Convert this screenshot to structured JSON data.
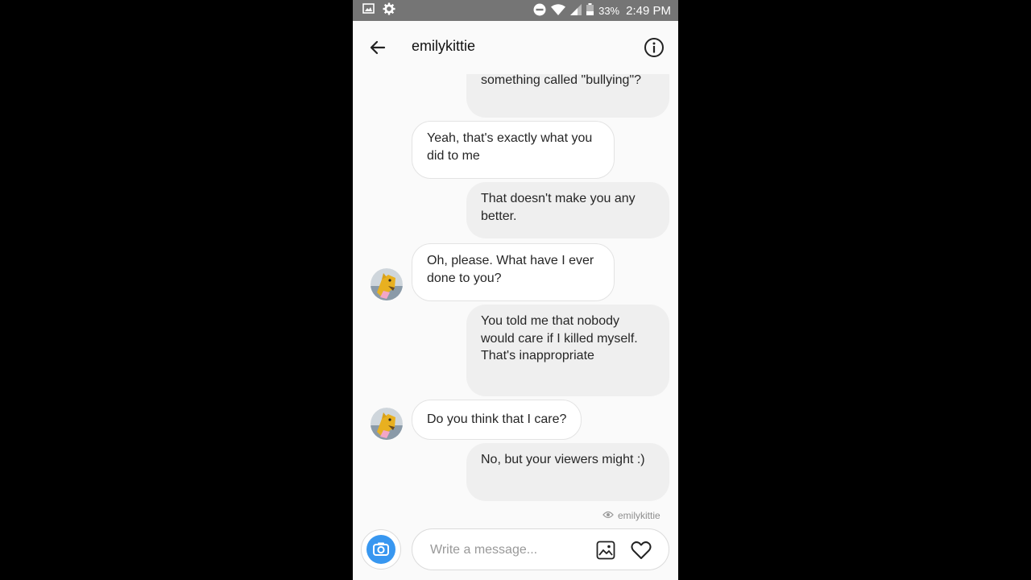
{
  "status_bar": {
    "battery": "33%",
    "time": "2:49 PM",
    "icons": [
      "image-icon",
      "settings-icon",
      "do-not-disturb-icon",
      "wifi-icon",
      "signal-icon",
      "battery-icon"
    ]
  },
  "header": {
    "title": "emilykittie",
    "back_icon": "back-arrow-icon",
    "info_icon": "info-icon"
  },
  "messages": [
    {
      "direction": "out",
      "text": "something called \"bullying\"?"
    },
    {
      "direction": "in",
      "text": "Yeah, that's exactly what you did to me"
    },
    {
      "direction": "out",
      "text": "That doesn't make you any better."
    },
    {
      "direction": "in",
      "text": "Oh, please. What have I ever done to you?",
      "avatar": true
    },
    {
      "direction": "out",
      "text": "You told me that nobody would care if I killed myself. That's inappropriate"
    },
    {
      "direction": "in",
      "text": "Do you think that I care?",
      "avatar": true
    },
    {
      "direction": "out",
      "text": "No, but your viewers might :)"
    }
  ],
  "seen_receipt": {
    "label": "emilykittie",
    "icon": "eye-icon"
  },
  "composer": {
    "placeholder": "Write a message...",
    "value": "",
    "camera_icon": "camera-icon",
    "gallery_icon": "gallery-icon",
    "like_icon": "heart-icon"
  },
  "colors": {
    "accent": "#3897f0",
    "outgoing_bubble": "#efefef",
    "incoming_bubble": "#ffffff",
    "status_bar": "#757575",
    "background": "#fafafa"
  }
}
